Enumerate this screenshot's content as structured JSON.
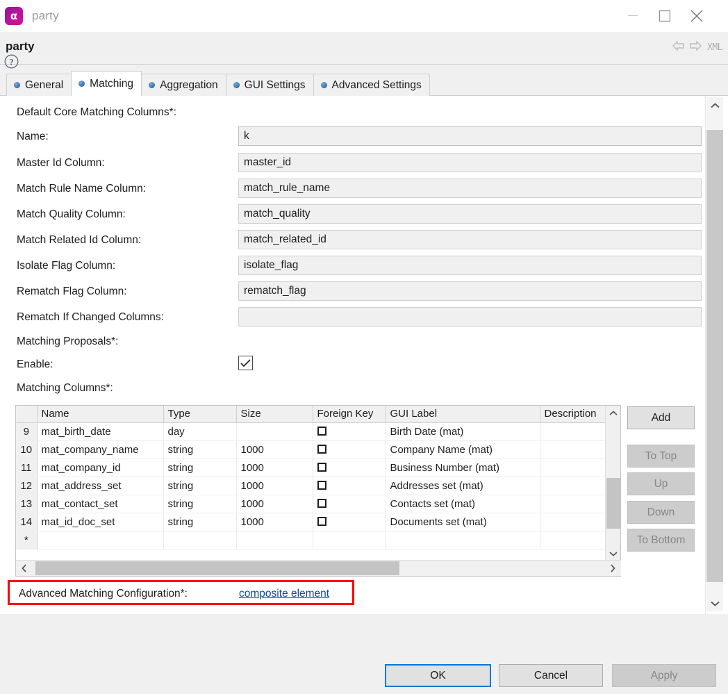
{
  "window": {
    "app_icon_glyph": "α",
    "title": "party",
    "minimize_label": "minimize-icon",
    "maximize_label": "maximize-icon",
    "close_label": "close-icon"
  },
  "header": {
    "title": "party",
    "back_icon": "back-arrow-icon",
    "forward_icon": "forward-arrow-icon",
    "xml_label": "XML"
  },
  "tabs": [
    {
      "label": "General",
      "active": false
    },
    {
      "label": "Matching",
      "active": true
    },
    {
      "label": "Aggregation",
      "active": false
    },
    {
      "label": "GUI Settings",
      "active": false
    },
    {
      "label": "Advanced Settings",
      "active": false
    }
  ],
  "form": {
    "section_core": "Default Core Matching Columns*:",
    "section_proposals": "Matching Proposals*:",
    "section_columns": "Matching Columns*:",
    "fields": [
      {
        "label": "Name:",
        "value": "k"
      },
      {
        "label": "Master Id Column:",
        "value": "master_id"
      },
      {
        "label": "Match Rule Name Column:",
        "value": "match_rule_name"
      },
      {
        "label": "Match Quality Column:",
        "value": "match_quality"
      },
      {
        "label": "Match Related Id Column:",
        "value": "match_related_id"
      },
      {
        "label": "Isolate Flag Column:",
        "value": "isolate_flag"
      },
      {
        "label": "Rematch Flag Column:",
        "value": "rematch_flag"
      },
      {
        "label": "Rematch If Changed Columns:",
        "value": ""
      }
    ],
    "enable": {
      "label": "Enable:",
      "checked": true
    }
  },
  "table": {
    "columns": [
      "",
      "Name",
      "Type",
      "Size",
      "Foreign Key",
      "GUI Label",
      "Description"
    ],
    "rows": [
      {
        "num": "9",
        "name": "mat_birth_date",
        "type": "day",
        "size": "",
        "fk": false,
        "gui": "Birth Date (mat)",
        "desc": ""
      },
      {
        "num": "10",
        "name": "mat_company_name",
        "type": "string",
        "size": "1000",
        "fk": false,
        "gui": "Company Name (mat)",
        "desc": ""
      },
      {
        "num": "11",
        "name": "mat_company_id",
        "type": "string",
        "size": "1000",
        "fk": false,
        "gui": "Business Number (mat)",
        "desc": ""
      },
      {
        "num": "12",
        "name": "mat_address_set",
        "type": "string",
        "size": "1000",
        "fk": false,
        "gui": "Addresses set (mat)",
        "desc": ""
      },
      {
        "num": "13",
        "name": "mat_contact_set",
        "type": "string",
        "size": "1000",
        "fk": false,
        "gui": "Contacts set (mat)",
        "desc": ""
      },
      {
        "num": "14",
        "name": "mat_id_doc_set",
        "type": "string",
        "size": "1000",
        "fk": false,
        "gui": "Documents set (mat)",
        "desc": ""
      },
      {
        "num": "*",
        "name": "",
        "type": "",
        "size": "",
        "fk": null,
        "gui": "",
        "desc": ""
      }
    ]
  },
  "side_buttons": [
    {
      "label": "Add",
      "enabled": true
    },
    {
      "label": "To Top",
      "enabled": false
    },
    {
      "label": "Up",
      "enabled": false
    },
    {
      "label": "Down",
      "enabled": false
    },
    {
      "label": "To Bottom",
      "enabled": false
    }
  ],
  "advanced": {
    "label": "Advanced Matching Configuration*:",
    "link": "composite element",
    "highlight_color": "#ff0000",
    "link_color": "#0d49a6"
  },
  "footer": {
    "help_icon": "help-icon",
    "buttons": [
      {
        "label": "OK",
        "enabled": true,
        "primary": true
      },
      {
        "label": "Cancel",
        "enabled": true,
        "primary": false
      },
      {
        "label": "Apply",
        "enabled": false,
        "primary": false
      }
    ]
  }
}
